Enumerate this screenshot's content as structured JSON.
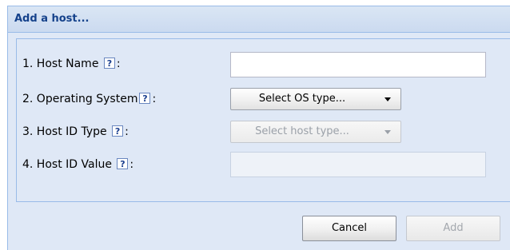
{
  "dialog": {
    "title": "Add a host...",
    "fields": [
      {
        "label": "1. Host Name",
        "help": "?",
        "suffix": ":",
        "value": ""
      },
      {
        "label": "2. Operating System",
        "help": "?",
        "suffix": ":",
        "selected": "Select OS type..."
      },
      {
        "label": "3. Host ID Type",
        "help": "?",
        "suffix": ":",
        "selected": "Select host type..."
      },
      {
        "label": "4. Host ID Value",
        "help": "?",
        "suffix": ":",
        "value": ""
      }
    ],
    "buttons": {
      "cancel": "Cancel",
      "add": "Add"
    }
  }
}
